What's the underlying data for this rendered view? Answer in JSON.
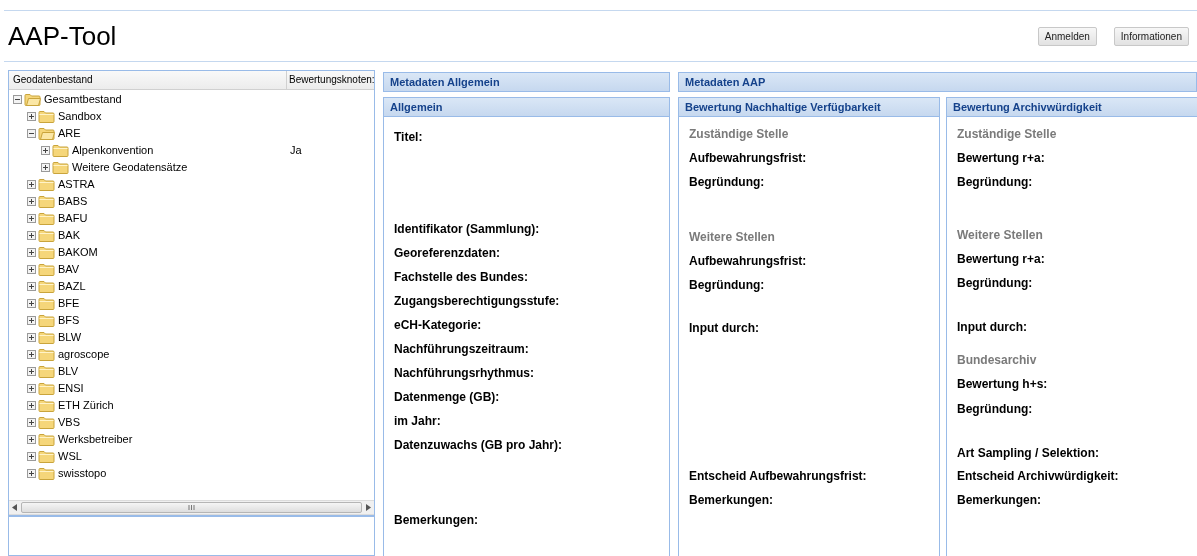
{
  "header": {
    "title": "AAP-Tool",
    "buttons": [
      "Anmelden",
      "Informationen"
    ]
  },
  "tree": {
    "columns": [
      "Geodatenbestand",
      "Bewertungsknoten:"
    ],
    "nodes": [
      {
        "label": "Gesamtbestand",
        "expanded": true,
        "children": [
          {
            "label": "Sandbox",
            "expanded": false
          },
          {
            "label": "ARE",
            "expanded": true,
            "children": [
              {
                "label": "Alpenkonvention",
                "expanded": false,
                "value": "Ja"
              },
              {
                "label": "Weitere Geodatensätze",
                "expanded": false
              }
            ]
          },
          {
            "label": "ASTRA",
            "expanded": false
          },
          {
            "label": "BABS",
            "expanded": false
          },
          {
            "label": "BAFU",
            "expanded": false
          },
          {
            "label": "BAK",
            "expanded": false
          },
          {
            "label": "BAKOM",
            "expanded": false
          },
          {
            "label": "BAV",
            "expanded": false
          },
          {
            "label": "BAZL",
            "expanded": false
          },
          {
            "label": "BFE",
            "expanded": false
          },
          {
            "label": "BFS",
            "expanded": false
          },
          {
            "label": "BLW",
            "expanded": false
          },
          {
            "label": "agroscope",
            "expanded": false
          },
          {
            "label": "BLV",
            "expanded": false
          },
          {
            "label": "ENSI",
            "expanded": false
          },
          {
            "label": "ETH Zürich",
            "expanded": false
          },
          {
            "label": "VBS",
            "expanded": false
          },
          {
            "label": "Werksbetreiber",
            "expanded": false
          },
          {
            "label": "WSL",
            "expanded": false
          },
          {
            "label": "swisstopo",
            "expanded": false
          }
        ]
      }
    ]
  },
  "general": {
    "title": "Metadaten Allgemein",
    "panel": {
      "title": "Allgemein",
      "rows": [
        {
          "kind": "field",
          "text": "Titel:"
        },
        {
          "kind": "field",
          "text": "Identifikator (Sammlung):"
        },
        {
          "kind": "field",
          "text": "Georeferenzdaten:"
        },
        {
          "kind": "field",
          "text": "Fachstelle des Bundes:"
        },
        {
          "kind": "field",
          "text": "Zugangsberechtigungsstufe:"
        },
        {
          "kind": "field",
          "text": "eCH-Kategorie:"
        },
        {
          "kind": "field",
          "text": "Nachführungszeitraum:"
        },
        {
          "kind": "field",
          "text": "Nachführungsrhythmus:"
        },
        {
          "kind": "field",
          "text": "Datenmenge (GB):"
        },
        {
          "kind": "field",
          "text": "im Jahr:"
        },
        {
          "kind": "field",
          "text": "Datenzuwachs (GB pro Jahr):"
        },
        {
          "kind": "field",
          "text": "Bemerkungen:"
        }
      ]
    }
  },
  "aap": {
    "title": "Metadaten AAP",
    "panels": [
      {
        "title": "Bewertung Nachhaltige Verfügbarkeit",
        "rows": [
          {
            "kind": "heading",
            "text": "Zuständige Stelle"
          },
          {
            "kind": "field",
            "text": "Aufbewahrungsfrist:"
          },
          {
            "kind": "field",
            "text": "Begründung:"
          },
          {
            "kind": "heading",
            "text": "Weitere Stellen"
          },
          {
            "kind": "field",
            "text": "Aufbewahrungsfrist:"
          },
          {
            "kind": "field",
            "text": "Begründung:"
          },
          {
            "kind": "field",
            "text": "Input durch:"
          },
          {
            "kind": "field",
            "text": "Entscheid Aufbewahrungsfrist:"
          },
          {
            "kind": "field",
            "text": "Bemerkungen:"
          }
        ]
      },
      {
        "title": "Bewertung Archivwürdigkeit",
        "rows": [
          {
            "kind": "heading",
            "text": "Zuständige Stelle"
          },
          {
            "kind": "field",
            "text": "Bewertung r+a:"
          },
          {
            "kind": "field",
            "text": "Begründung:"
          },
          {
            "kind": "heading",
            "text": "Weitere Stellen"
          },
          {
            "kind": "field",
            "text": "Bewertung r+a:"
          },
          {
            "kind": "field",
            "text": "Begründung:"
          },
          {
            "kind": "field",
            "text": "Input durch:"
          },
          {
            "kind": "heading",
            "text": "Bundesarchiv"
          },
          {
            "kind": "field",
            "text": "Bewertung h+s:"
          },
          {
            "kind": "field",
            "text": "Begründung:"
          },
          {
            "kind": "field",
            "text": "Art Sampling / Selektion:"
          },
          {
            "kind": "field",
            "text": "Entscheid Archivwürdigkeit:"
          },
          {
            "kind": "field",
            "text": "Bemerkungen:"
          }
        ]
      }
    ]
  }
}
